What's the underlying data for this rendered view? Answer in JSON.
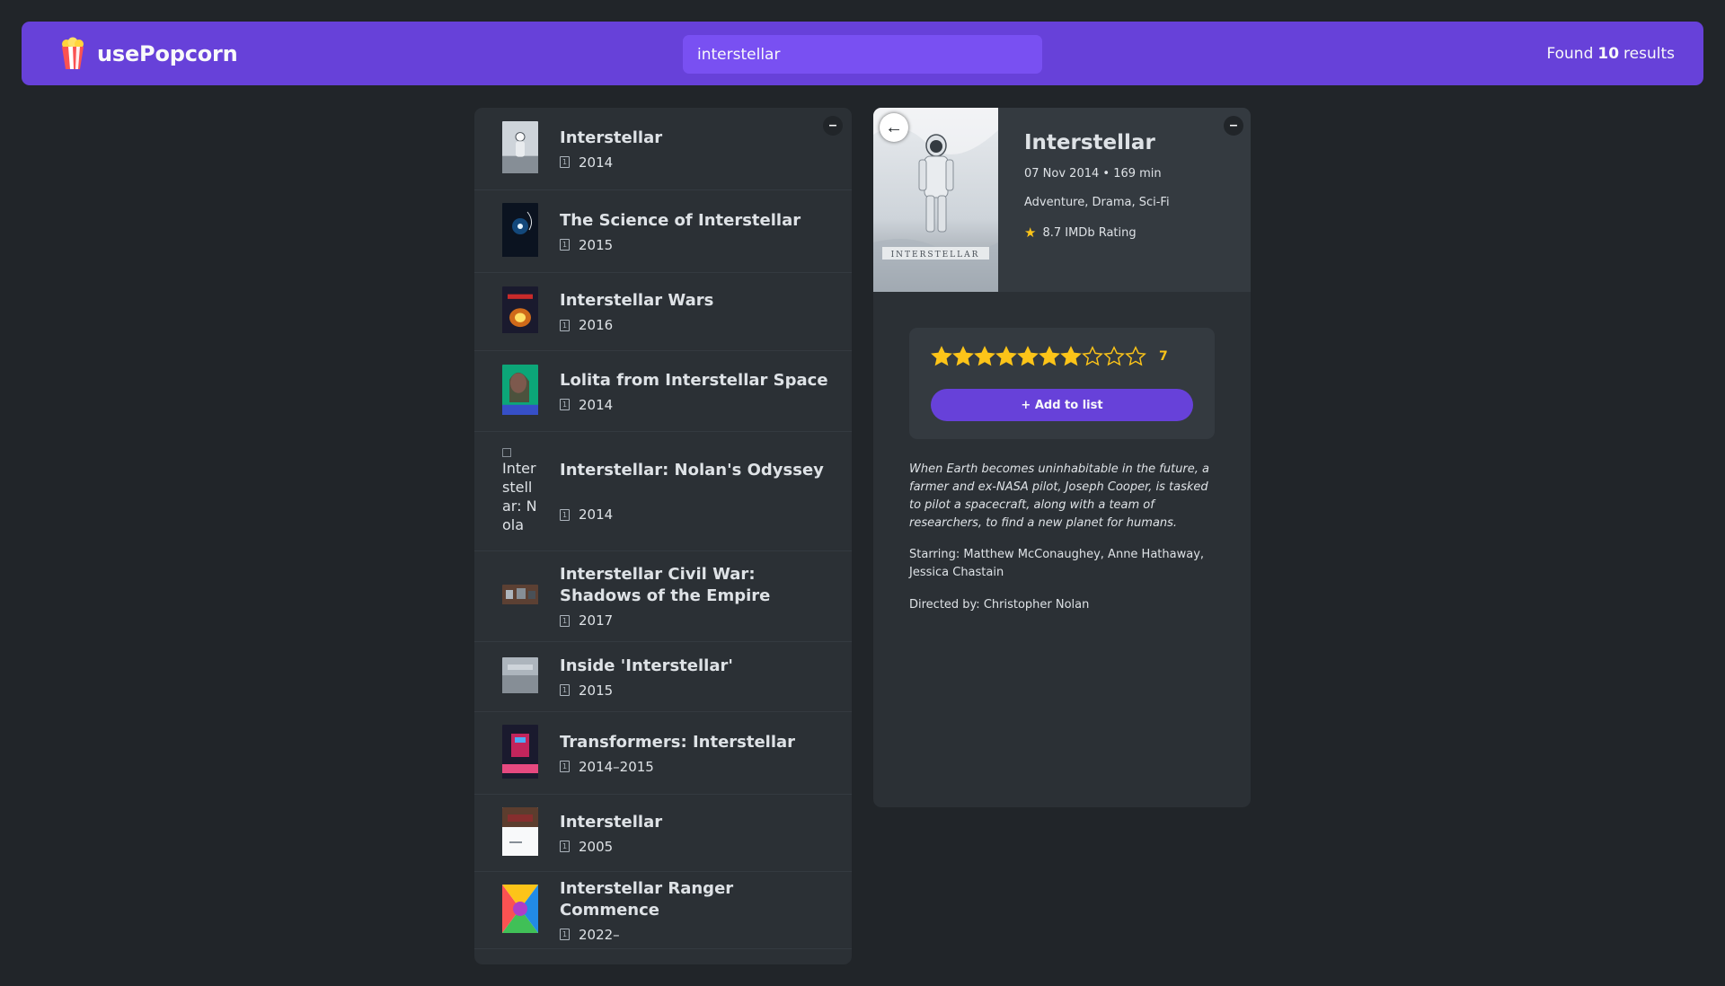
{
  "nav": {
    "logo_text": "usePopcorn",
    "search_value": "interstellar",
    "results_prefix": "Found",
    "results_count": "10",
    "results_suffix": "results"
  },
  "list": {
    "toggle_label": "–",
    "movies": [
      {
        "title": "Interstellar",
        "year": "2014",
        "poster": "astronaut"
      },
      {
        "title": "The Science of Interstellar",
        "year": "2015",
        "poster": "space"
      },
      {
        "title": "Interstellar Wars",
        "year": "2016",
        "poster": "explosion"
      },
      {
        "title": "Lolita from Interstellar Space",
        "year": "2014",
        "poster": "portrait"
      },
      {
        "title": "Interstellar: Nolan's Odyssey",
        "year": "2014",
        "poster": "broken",
        "poster_alt": "Interstellar: Nolan's Odyssey poster"
      },
      {
        "title": "Interstellar Civil War: Shadows of the Empire",
        "year": "2017",
        "poster": "wide"
      },
      {
        "title": "Inside 'Interstellar'",
        "year": "2015",
        "poster": "gray"
      },
      {
        "title": "Transformers: Interstellar",
        "year": "2014–2015",
        "poster": "robot"
      },
      {
        "title": "Interstellar",
        "year": "2005",
        "poster": "white"
      },
      {
        "title": "Interstellar Ranger Commence",
        "year": "2022–",
        "poster": "colorful"
      }
    ]
  },
  "details": {
    "back_label": "←",
    "toggle_label": "–",
    "title": "Interstellar",
    "released_runtime": "07 Nov 2014 • 169 min",
    "genre": "Adventure, Drama, Sci-Fi",
    "imdb_rating": "8.7 IMDb Rating",
    "user_rating": 7,
    "max_rating": 10,
    "user_rating_label": "7",
    "add_button": "+ Add to list",
    "plot": "When Earth becomes uninhabitable in the future, a farmer and ex-NASA pilot, Joseph Cooper, is tasked to pilot a spacecraft, along with a team of researchers, to find a new planet for humans.",
    "starring": "Starring: Matthew McConaughey, Anne Hathaway, Jessica Chastain",
    "director": "Directed by: Christopher Nolan"
  },
  "colors": {
    "primary": "#6741d9",
    "primary_light": "#7950f2",
    "background": "#212529",
    "box": "#2b3035",
    "star": "#fcc419"
  }
}
